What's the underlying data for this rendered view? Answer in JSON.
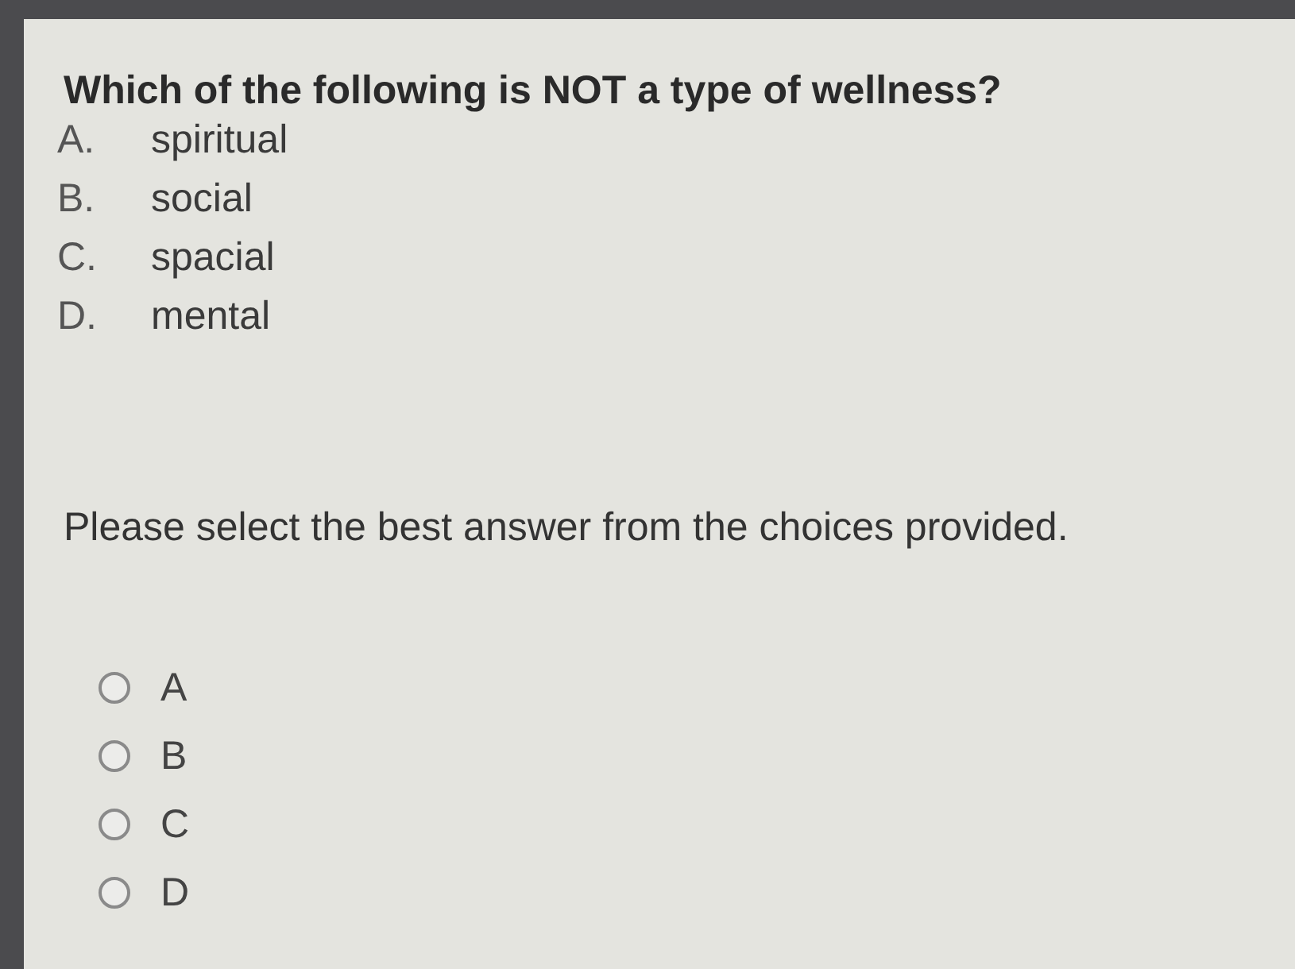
{
  "question": "Which of the following is NOT a type of wellness?",
  "options": [
    {
      "letter": "A.",
      "text": "spiritual"
    },
    {
      "letter": "B.",
      "text": "social"
    },
    {
      "letter": "C.",
      "text": "spacial"
    },
    {
      "letter": "D.",
      "text": "mental"
    }
  ],
  "instruction": "Please select the best answer from the choices provided.",
  "choices": [
    {
      "label": "A",
      "selected": false
    },
    {
      "label": "B",
      "selected": false
    },
    {
      "label": "C",
      "selected": false
    },
    {
      "label": "D",
      "selected": false
    }
  ]
}
